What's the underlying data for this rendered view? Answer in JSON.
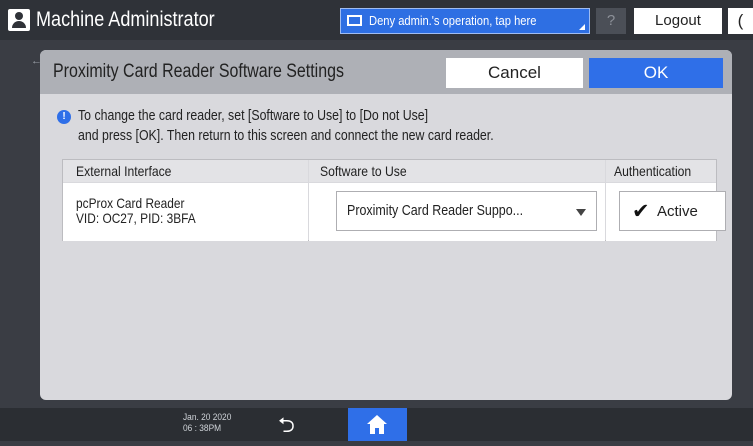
{
  "topbar": {
    "user_icon": "person-icon",
    "title": "Machine Administrator",
    "deny_label": "Deny admin.'s operation, tap here",
    "help_label": "?",
    "logout_label": "Logout",
    "moon_label": "("
  },
  "dialog": {
    "title": "Proximity Card Reader Software Settings",
    "cancel_label": "Cancel",
    "ok_label": "OK",
    "info_line1": "To change the card reader, set [Software to Use] to [Do not Use]",
    "info_line2": "and press [OK]. Then return to this screen and connect the new card reader.",
    "table": {
      "headers": [
        "External Interface",
        "Software to Use",
        "Authentication"
      ],
      "rows": [
        {
          "interface_name": "pcProx Card Reader",
          "interface_id": "VID: OC27, PID: 3BFA",
          "software": "Proximity Card Reader Suppo...",
          "auth_checked": true,
          "auth_label": "Active"
        }
      ]
    }
  },
  "bottombar": {
    "date": "Jan. 20 2020",
    "time": "06 : 38PM"
  },
  "colors": {
    "accent": "#2f6fe8",
    "topbar": "#2f3238",
    "dialog_bg": "#d9d9dd",
    "dialog_header": "#aeb0b6"
  }
}
